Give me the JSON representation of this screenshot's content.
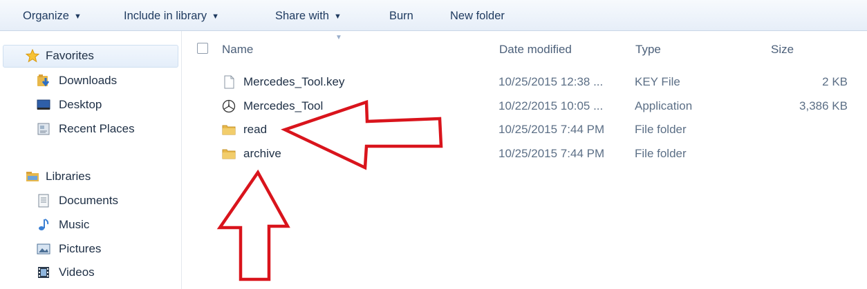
{
  "toolbar": {
    "organize": "Organize",
    "include_in_library": "Include in library",
    "share_with": "Share with",
    "burn": "Burn",
    "new_folder": "New folder"
  },
  "nav": {
    "favorites": {
      "label": "Favorites",
      "items": [
        "Downloads",
        "Desktop",
        "Recent Places"
      ]
    },
    "libraries": {
      "label": "Libraries",
      "items": [
        "Documents",
        "Music",
        "Pictures",
        "Videos"
      ]
    }
  },
  "columns": {
    "name": "Name",
    "date_modified": "Date modified",
    "type": "Type",
    "size": "Size"
  },
  "files": [
    {
      "name": "Mercedes_Tool.key",
      "date": "10/25/2015 12:38 ...",
      "type": "KEY File",
      "size": "2 KB",
      "icon": "document-icon"
    },
    {
      "name": "Mercedes_Tool",
      "date": "10/22/2015 10:05 ...",
      "type": "Application",
      "size": "3,386 KB",
      "icon": "mercedes-logo-icon"
    },
    {
      "name": "read",
      "date": "10/25/2015 7:44 PM",
      "type": "File folder",
      "size": "",
      "icon": "folder-icon"
    },
    {
      "name": "archive",
      "date": "10/25/2015 7:44 PM",
      "type": "File folder",
      "size": "",
      "icon": "folder-icon"
    }
  ],
  "colors": {
    "toolbar_text": "#1e3a5f",
    "annotation_arrow": "#d9141c",
    "folder": "#e8b84a"
  }
}
